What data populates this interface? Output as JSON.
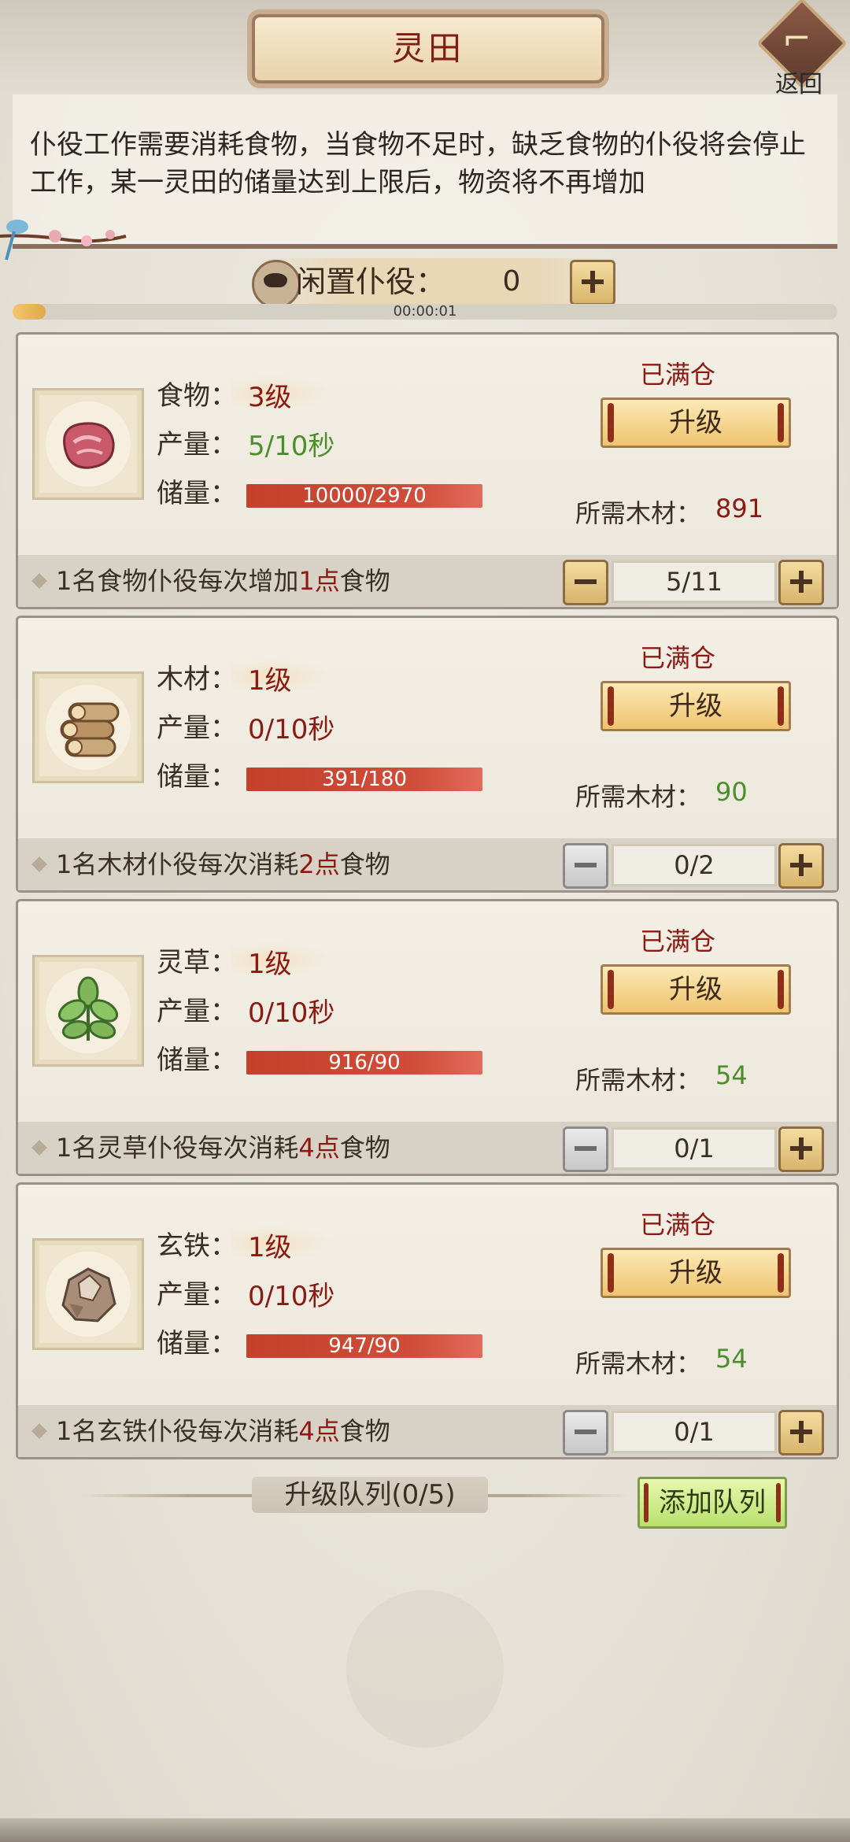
{
  "header": {
    "title": "灵田",
    "back_label": "返回"
  },
  "intro": {
    "text": "仆役工作需要消耗食物，当食物不足时，缺乏食物的仆役将会停止工作，某一灵田的储量达到上限后，物资将不再增加"
  },
  "idle": {
    "label": "闲置仆役：",
    "count": "0",
    "timer": "00:00:01",
    "timer_progress": 0.04
  },
  "labels": {
    "output": "产量：",
    "storage": "储量：",
    "full": "已满仓",
    "upgrade": "升级",
    "wood_needed": "所需木材："
  },
  "fields": [
    {
      "name": "食物：",
      "level": "3级",
      "rate": "5/10秒",
      "rate_color": "green",
      "storage": "10000/2970",
      "wood": "891",
      "wood_color": "red",
      "footer_pre": "1名食物仆役每次增加",
      "footer_pts": "1点",
      "footer_post": "食物",
      "workers": "5/11",
      "minus_enabled": true,
      "icon": "meat-icon"
    },
    {
      "name": "木材：",
      "level": "1级",
      "rate": "0/10秒",
      "rate_color": "red",
      "storage": "391/180",
      "wood": "90",
      "wood_color": "green",
      "footer_pre": "1名木材仆役每次消耗",
      "footer_pts": "2点",
      "footer_post": "食物",
      "workers": "0/2",
      "minus_enabled": false,
      "icon": "log-icon"
    },
    {
      "name": "灵草：",
      "level": "1级",
      "rate": "0/10秒",
      "rate_color": "red",
      "storage": "916/90",
      "wood": "54",
      "wood_color": "green",
      "footer_pre": "1名灵草仆役每次消耗",
      "footer_pts": "4点",
      "footer_post": "食物",
      "workers": "0/1",
      "minus_enabled": false,
      "icon": "herb-icon"
    },
    {
      "name": "玄铁：",
      "level": "1级",
      "rate": "0/10秒",
      "rate_color": "red",
      "storage": "947/90",
      "wood": "54",
      "wood_color": "green",
      "footer_pre": "1名玄铁仆役每次消耗",
      "footer_pts": "4点",
      "footer_post": "食物",
      "workers": "0/1",
      "minus_enabled": false,
      "icon": "ore-icon"
    }
  ],
  "queue": {
    "label": "升级队列(0/5)",
    "add_label": "添加队列"
  }
}
